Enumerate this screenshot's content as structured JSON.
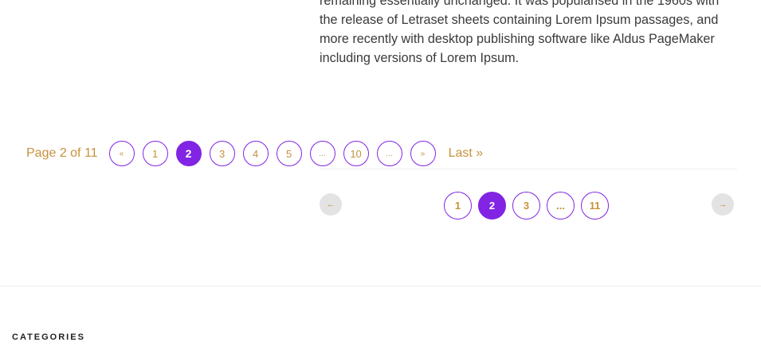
{
  "article": {
    "lines": [
      "remaining essentially unchanged. It was popularised in the 1960s with",
      "the release of Letraset sheets containing Lorem Ipsum passages, and",
      "more recently with desktop publishing software like Aldus PageMaker",
      "including versions of Lorem Ipsum."
    ]
  },
  "pagination_top": {
    "info": "Page 2 of 11",
    "first": "«",
    "pages": [
      "1",
      "2",
      "3",
      "4",
      "5",
      "...",
      "10",
      "...",
      "»"
    ],
    "current": "2",
    "last": "Last »"
  },
  "pagination_bottom": {
    "prev_icon": "arrow-left-icon",
    "prev_glyph": "←",
    "pages": [
      "1",
      "2",
      "3",
      "...",
      "11"
    ],
    "current": "2",
    "next_icon": "arrow-right-icon",
    "next_glyph": "→"
  },
  "sidebar": {
    "categories_title": "CATEGORIES"
  },
  "colors": {
    "accent": "#8224e3",
    "link": "#c8913b",
    "arrow_bg": "#e3e3e3"
  }
}
